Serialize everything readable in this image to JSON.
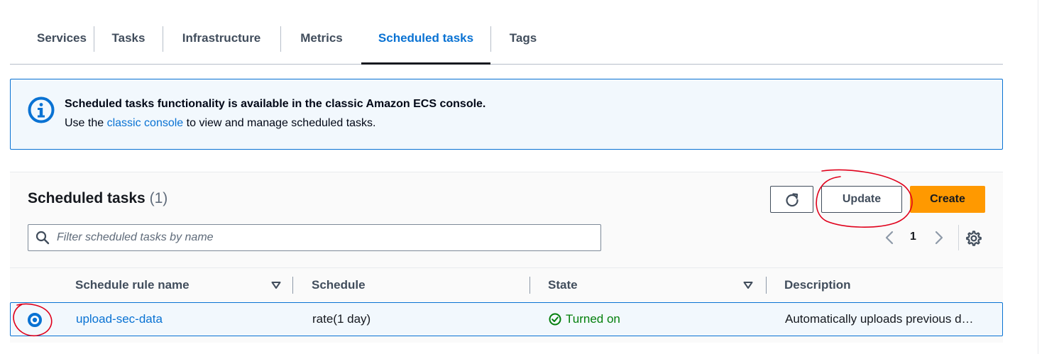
{
  "tabs": [
    {
      "label": "Services",
      "active": false
    },
    {
      "label": "Tasks",
      "active": false
    },
    {
      "label": "Infrastructure",
      "active": false
    },
    {
      "label": "Metrics",
      "active": false
    },
    {
      "label": "Scheduled tasks",
      "active": true
    },
    {
      "label": "Tags",
      "active": false
    }
  ],
  "alert": {
    "icon": "info-icon",
    "title": "Scheduled tasks functionality is available in the classic Amazon ECS console.",
    "body_prefix": "Use the ",
    "link_text": "classic console",
    "body_suffix": " to view and manage scheduled tasks."
  },
  "panel": {
    "title": "Scheduled tasks",
    "count": "(1)",
    "refresh_icon": "refresh-icon",
    "update_label": "Update",
    "create_label": "Create",
    "filter_placeholder": "Filter scheduled tasks by name",
    "filter_value": "",
    "page_number": "1"
  },
  "table": {
    "columns": [
      "Schedule rule name",
      "Schedule",
      "State",
      "Description"
    ],
    "rows": [
      {
        "selected": true,
        "name": "upload-sec-data",
        "schedule": "rate(1 day)",
        "state": "Turned on",
        "description": "Automatically uploads previous d…"
      }
    ]
  },
  "colors": {
    "accent": "#0972d3",
    "primary_button": "#ff9900",
    "success": "#037f0c",
    "annotation": "#e0001b"
  }
}
